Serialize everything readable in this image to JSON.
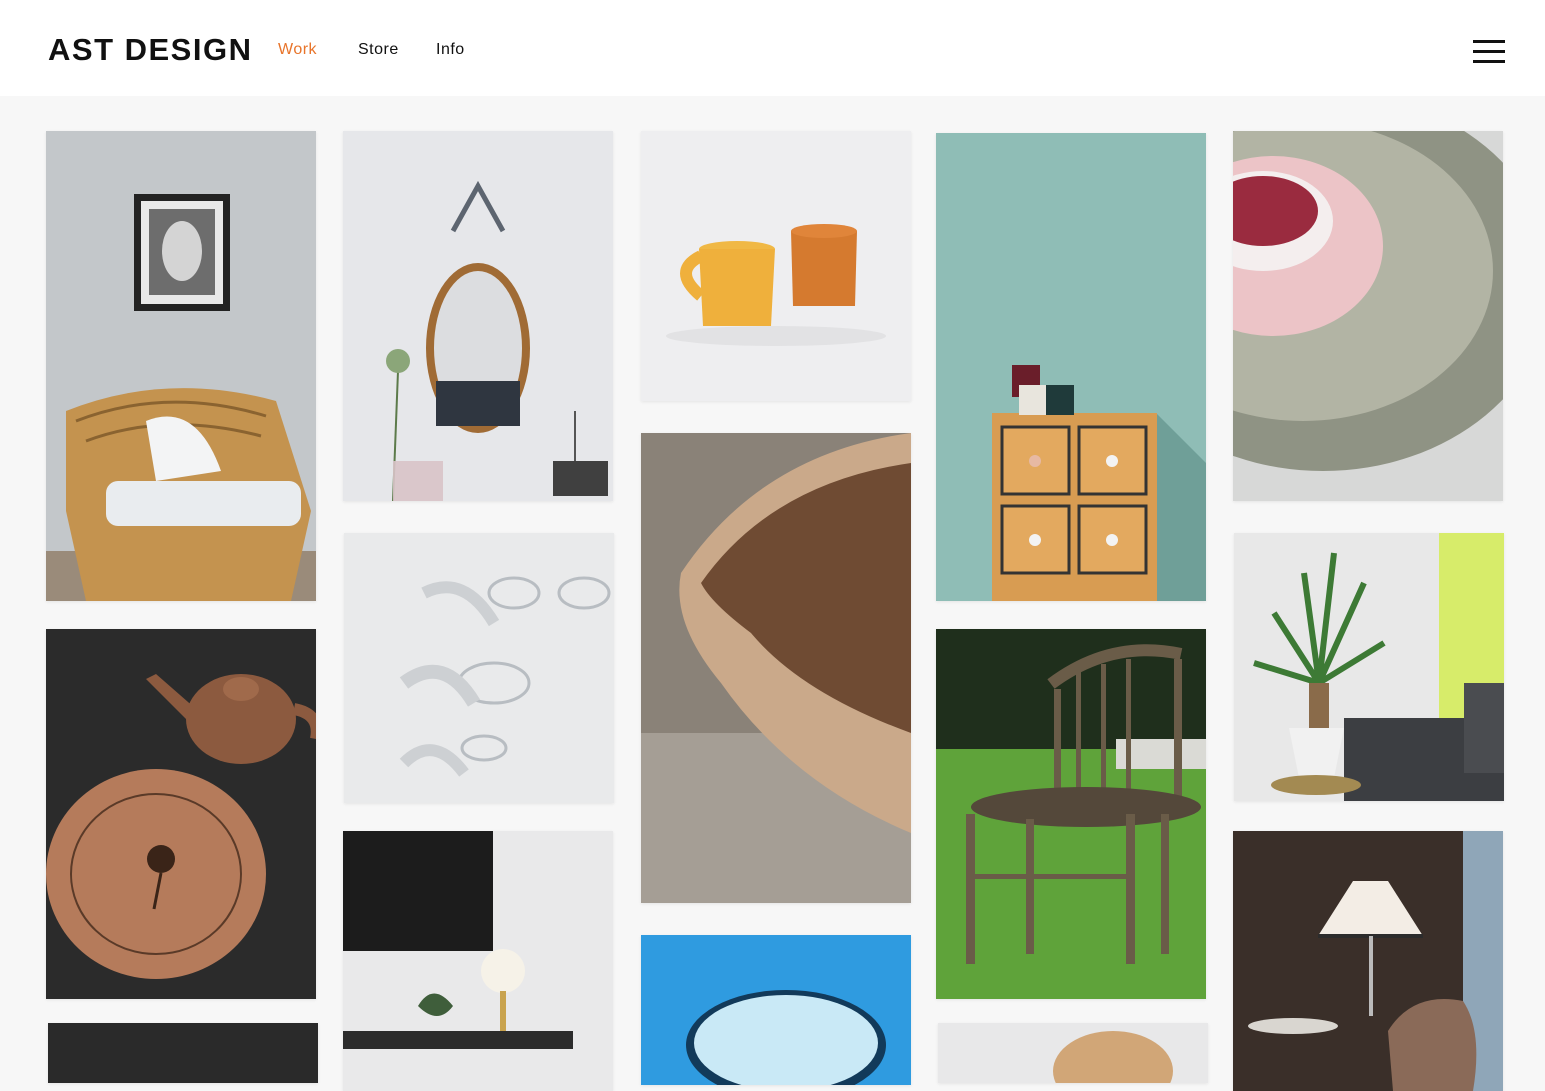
{
  "header": {
    "logo": "AST DESIGN",
    "nav": [
      {
        "label": "Work",
        "active": true
      },
      {
        "label": "Store",
        "active": false
      },
      {
        "label": "Info",
        "active": false
      }
    ],
    "menu_icon": "hamburger-menu-icon"
  },
  "colors": {
    "accent": "#e8742a",
    "text": "#111111",
    "background": "#f7f7f7"
  },
  "gallery": {
    "columns": 5,
    "tiles": [
      {
        "subject": "rattan-armchair"
      },
      {
        "subject": "oval-mirror"
      },
      {
        "subject": "ceramic-cups"
      },
      {
        "subject": "wooden-drawer-cabinet"
      },
      {
        "subject": "pink-ceramic-bowls"
      },
      {
        "subject": "clay-teapot-and-plate"
      },
      {
        "subject": "glassware-shadows"
      },
      {
        "subject": "wooden-bowl-closeup"
      },
      {
        "subject": "wooden-chair-on-grass"
      },
      {
        "subject": "potted-palm-and-sofa"
      },
      {
        "subject": "desk-lamp-with-tv"
      },
      {
        "subject": "blue-plate"
      },
      {
        "subject": "lampshade-and-armchair"
      },
      {
        "subject": "dark-photo-partial"
      },
      {
        "subject": "wooden-stool-partial"
      }
    ]
  }
}
